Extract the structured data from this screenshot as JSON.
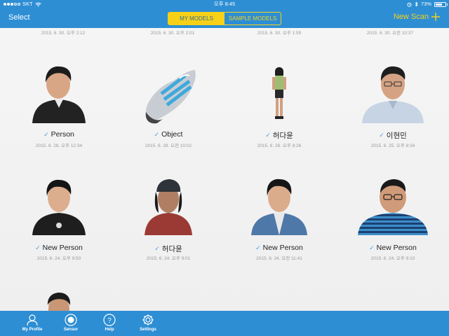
{
  "status_bar": {
    "carrier": "SKT",
    "time": "오후 8:45",
    "battery": "73%",
    "battery_level": 0.73
  },
  "nav": {
    "left_label": "Select",
    "segments": [
      {
        "label": "MY MODELS",
        "active": true
      },
      {
        "label": "SAMPLE MODELS",
        "active": false
      }
    ],
    "right_label": "New Scan",
    "right_icon": "plus-icon"
  },
  "top_row_dates": [
    "2015. 6. 30. 오후 2:12",
    "2015. 6. 30. 오후 2:01",
    "2015. 6. 30. 오후 1:59",
    "2015. 6. 30. 오전 10:37"
  ],
  "models": [
    {
      "name": "Person",
      "date": "2015. 6. 28. 오후 12:34",
      "thumb": "bust-boy-icon"
    },
    {
      "name": "Object",
      "date": "2015. 6. 28. 오전 10:02",
      "thumb": "shoe-icon"
    },
    {
      "name": "허다윤",
      "date": "2015. 6. 26. 오후 8:26",
      "thumb": "full-body-girl-icon"
    },
    {
      "name": "이현민",
      "date": "2015. 6. 25. 오후 8:34",
      "thumb": "bust-man-glasses-icon"
    },
    {
      "name": "New Person",
      "date": "2015. 6. 24. 오후 9:50",
      "thumb": "bust-boy-black-shirt-icon"
    },
    {
      "name": "허다윤",
      "date": "2015. 6. 24. 오후 9:01",
      "thumb": "bust-girl-cap-icon"
    },
    {
      "name": "New Person",
      "date": "2015. 6. 24. 오전 11:41",
      "thumb": "bust-boy-denim-icon"
    },
    {
      "name": "New Person",
      "date": "2015. 6. 24. 오후 9:10",
      "thumb": "bust-man-striped-icon"
    }
  ],
  "tabs": [
    {
      "label": "My Profile",
      "icon": "person-icon"
    },
    {
      "label": "Sensor",
      "icon": "sensor-icon"
    },
    {
      "label": "Help",
      "icon": "help-icon"
    },
    {
      "label": "Settings",
      "icon": "gear-icon"
    }
  ],
  "colors": {
    "bar_blue": "#2d8ed4",
    "accent_yellow": "#f7d117",
    "check_blue": "#4a9de0"
  }
}
